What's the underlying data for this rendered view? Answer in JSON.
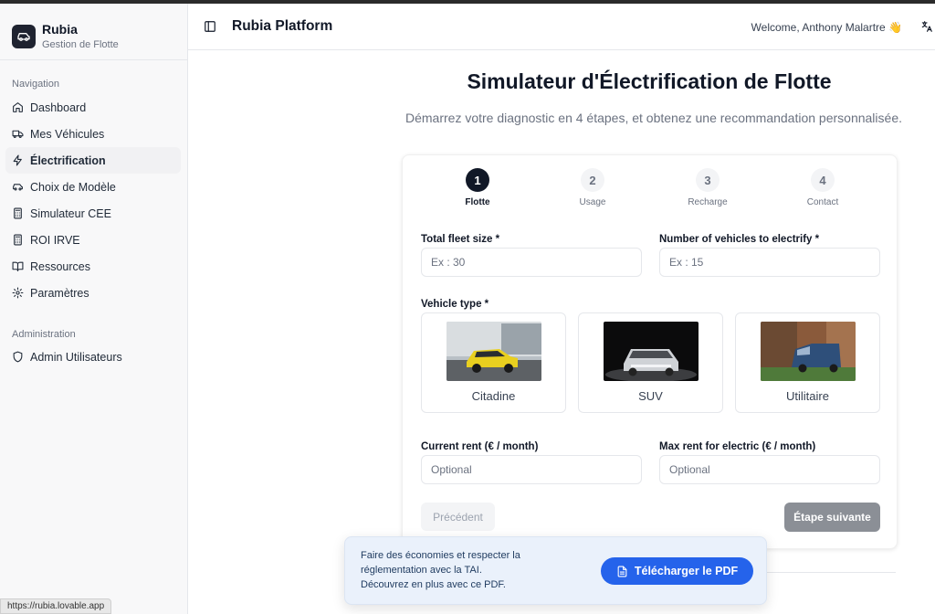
{
  "brand": {
    "name": "Rubia",
    "subtitle": "Gestion de Flotte"
  },
  "sidebar": {
    "nav_title": "Navigation",
    "items": [
      {
        "label": "Dashboard",
        "icon": "home-icon",
        "active": false
      },
      {
        "label": "Mes Véhicules",
        "icon": "truck-icon",
        "active": false
      },
      {
        "label": "Électrification",
        "icon": "zap-icon",
        "active": true
      },
      {
        "label": "Choix de Modèle",
        "icon": "car-icon",
        "active": false
      },
      {
        "label": "Simulateur CEE",
        "icon": "calculator-icon",
        "active": false
      },
      {
        "label": "ROI IRVE",
        "icon": "calculator-icon",
        "active": false
      },
      {
        "label": "Ressources",
        "icon": "book-icon",
        "active": false
      },
      {
        "label": "Paramètres",
        "icon": "gear-icon",
        "active": false
      }
    ],
    "admin_title": "Administration",
    "admin_items": [
      {
        "label": "Admin Utilisateurs",
        "icon": "shield-icon"
      }
    ]
  },
  "header": {
    "title": "Rubia Platform",
    "welcome": "Welcome, Anthony Malartre 👋",
    "toggle_icon": "sidebar-toggle-icon",
    "lang_icon": "translate-icon"
  },
  "main": {
    "title": "Simulateur d'Électrification de Flotte",
    "subtitle": "Démarrez votre diagnostic en 4 étapes, et obtenez une recommandation personnalisée."
  },
  "steps": [
    {
      "number": "1",
      "label": "Flotte",
      "active": true
    },
    {
      "number": "2",
      "label": "Usage",
      "active": false
    },
    {
      "number": "3",
      "label": "Recharge",
      "active": false
    },
    {
      "number": "4",
      "label": "Contact",
      "active": false
    }
  ],
  "form": {
    "fleet_size": {
      "label": "Total fleet size *",
      "placeholder": "Ex : 30",
      "value": ""
    },
    "vehicles_to_electrify": {
      "label": "Number of vehicles to electrify *",
      "placeholder": "Ex : 15",
      "value": ""
    },
    "vehicle_type_label": "Vehicle type *",
    "vehicle_types": [
      {
        "label": "Citadine"
      },
      {
        "label": "SUV"
      },
      {
        "label": "Utilitaire"
      }
    ],
    "current_rent": {
      "label": "Current rent (€ / month)",
      "placeholder": "Optional",
      "value": ""
    },
    "max_rent": {
      "label": "Max rent for electric (€ / month)",
      "placeholder": "Optional",
      "value": ""
    },
    "prev_button": "Précédent",
    "next_button": "Étape suivante"
  },
  "promo": {
    "line1": "Faire des économies et respecter la",
    "line2": "réglementation avec la TAI.",
    "line3": "Découvrez en plus avec ce PDF.",
    "button": "Télécharger le PDF",
    "button_icon": "file-text-icon"
  },
  "status_url": "https://rubia.lovable.app",
  "colors": {
    "accent": "#2563eb",
    "active_step": "#111827",
    "next_button": "#8b8f96"
  }
}
